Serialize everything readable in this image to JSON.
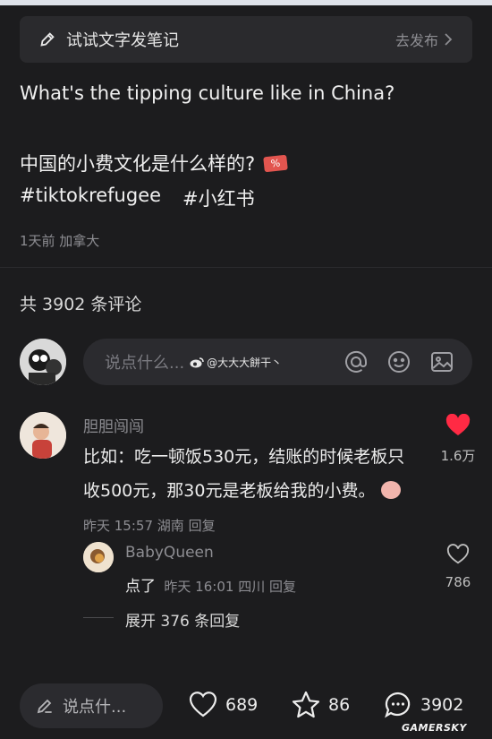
{
  "draft_bar": {
    "title": "试试文字发笔记",
    "action": "去发布"
  },
  "post": {
    "text_en": "What's the tipping culture like in China?",
    "text_cn": "中国的小费文化是什么样的?",
    "hashtags": [
      "#tiktokrefugee",
      "#小红书"
    ],
    "meta": "1天前 加拿大"
  },
  "comments_header": {
    "count_label": "共 3902 条评论"
  },
  "comment_input": {
    "placeholder": "说点什么...",
    "watermark": "@大大大餅干丶",
    "icons": [
      "at-icon",
      "emoji-icon",
      "image-icon"
    ]
  },
  "comments": [
    {
      "author": "胆胆闯闯",
      "text": "比如：吃一顿饭530元，结账的时候老板只收500元，那30元是老板给我的小费。",
      "time": "昨天 15:57",
      "location": "湖南",
      "reply_label": "回复",
      "likes": "1.6万",
      "liked": true,
      "replies": [
        {
          "author": "BabyQueen",
          "text": "点了",
          "time": "昨天 16:01",
          "location": "四川",
          "reply_label": "回复",
          "likes": "786"
        }
      ],
      "expand_label": "展开 376 条回复"
    }
  ],
  "bottom_bar": {
    "input_placeholder": "说点什...",
    "likes": "689",
    "stars": "86",
    "comments": "3902"
  },
  "watermark_text": "GAMERSKY",
  "colors": {
    "background": "#1c1c1e",
    "like_red": "#ff2a44",
    "muted": "#8d8d92"
  }
}
